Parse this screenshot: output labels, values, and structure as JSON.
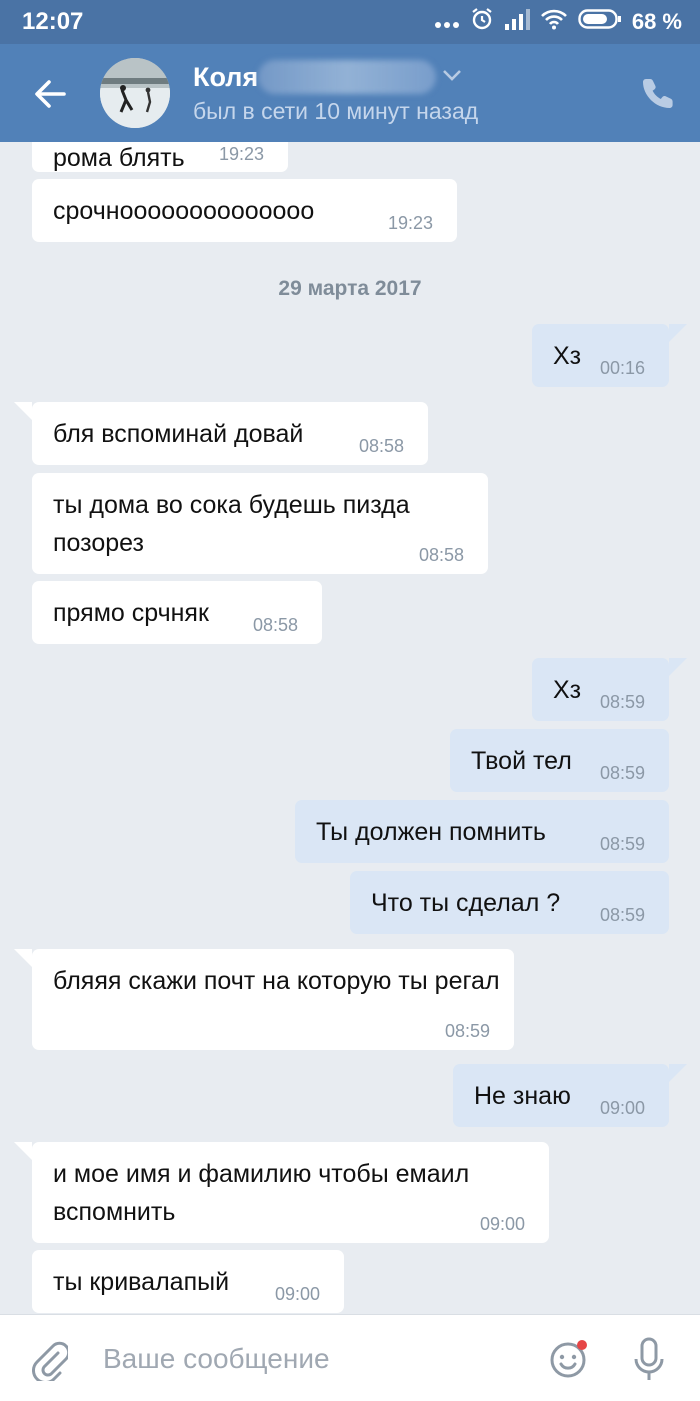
{
  "status_bar": {
    "time": "12:07",
    "battery": "68 %"
  },
  "header": {
    "back_icon": "arrow-left-icon",
    "name": "Коля",
    "presence": "был в сети 10 минут назад",
    "call_icon": "phone-icon"
  },
  "messages": [
    {
      "dir": "in",
      "text": "рома блять",
      "time": "19:23"
    },
    {
      "dir": "in",
      "text": "срочноооооооооооооо",
      "time": "19:23"
    },
    {
      "dir": "date",
      "text": "29 марта 2017"
    },
    {
      "dir": "out",
      "text": "Хз",
      "time": "00:16"
    },
    {
      "dir": "in",
      "text": "бля вспоминай довай",
      "time": "08:58"
    },
    {
      "dir": "in",
      "text": "ты дома во сока будешь пизда позорез",
      "time": "08:58"
    },
    {
      "dir": "in",
      "text": "прямо срчняк",
      "time": "08:58"
    },
    {
      "dir": "out",
      "text": "Хз",
      "time": "08:59"
    },
    {
      "dir": "out",
      "text": "Твой тел",
      "time": "08:59"
    },
    {
      "dir": "out",
      "text": "Ты должен помнить",
      "time": "08:59"
    },
    {
      "dir": "out",
      "text": "Что ты сделал ?",
      "time": "08:59"
    },
    {
      "dir": "in",
      "text": "бляяя скажи почт на которую ты регал",
      "time": "08:59"
    },
    {
      "dir": "out",
      "text": "Не знаю",
      "time": "09:00"
    },
    {
      "dir": "in",
      "text": "и мое имя и фамилию чтобы емаил вспомнить",
      "time": "09:00"
    },
    {
      "dir": "in",
      "text": "ты кривалапый",
      "time": "09:00"
    }
  ],
  "composer": {
    "placeholder": "Ваше сообщение",
    "attach_icon": "paperclip-icon",
    "sticker_icon": "smile-icon",
    "voice_icon": "microphone-icon"
  },
  "colors": {
    "header": "#5181b8",
    "status_bar": "#4a73a5",
    "incoming": "#ffffff",
    "outgoing": "#dae6f5",
    "background": "#e8ecf1"
  }
}
